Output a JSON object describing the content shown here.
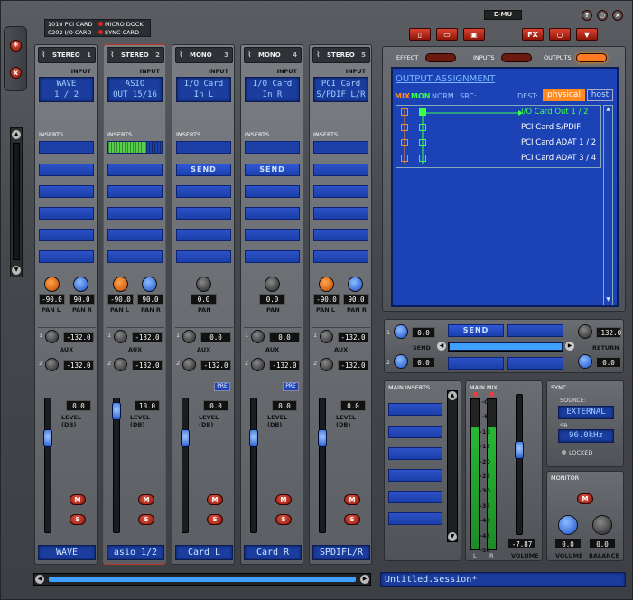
{
  "cards": {
    "line1": "1010 PCI CARD",
    "line2": "0202 I/O CARD",
    "micro": "MICRO DOCK",
    "sync": "SYNC CARD"
  },
  "brand": "E-MU",
  "window": {
    "help": "?",
    "min": "○",
    "close": "×"
  },
  "toolbar": {
    "fx": "FX",
    "labels": {
      "effect": "EFFECT",
      "inputs": "INPUTS",
      "outputs": "OUTPUTS"
    }
  },
  "side": {
    "star": "*",
    "x": "x"
  },
  "common": {
    "input": "INPUT",
    "inserts": "INSERTS",
    "send": "SEND",
    "pan": "PAN",
    "panl": "PAN L",
    "panr": "PAN R",
    "aux": "AUX",
    "level": "LEVEL (DB)",
    "mute": "M",
    "solo": "S",
    "pre": "PRE"
  },
  "strips": [
    {
      "type": "STEREO",
      "num": "1",
      "src1": "WAVE",
      "src2": "1 / 2",
      "stereo": true,
      "panL": "-90.0",
      "panR": "90.0",
      "aux1": "-132.0",
      "aux2": "-132.0",
      "level": "0.0",
      "name": "WAVE",
      "pre": false
    },
    {
      "type": "STEREO",
      "num": "2",
      "src1": "ASIO",
      "src2": "OUT 15/16",
      "stereo": true,
      "panL": "-90.0",
      "panR": "90.0",
      "aux1": "-132.0",
      "aux2": "-132.0",
      "level": "10.0",
      "name": "asio 1/2",
      "pre": false
    },
    {
      "type": "MONO",
      "num": "3",
      "src1": "I/O Card",
      "src2": "In L",
      "stereo": false,
      "pan": "0.0",
      "aux1": "0.0",
      "aux2": "-132.0",
      "level": "0.0",
      "name": "Card L",
      "pre": true
    },
    {
      "type": "MONO",
      "num": "4",
      "src1": "I/O Card",
      "src2": "In R",
      "stereo": false,
      "pan": "0.0",
      "aux1": "0.0",
      "aux2": "-132.0",
      "level": "0.0",
      "name": "Card R",
      "pre": true
    },
    {
      "type": "STEREO",
      "num": "5",
      "src1": "PCI Card",
      "src2": "S/PDIF L/R",
      "stereo": true,
      "panL": "-90.0",
      "panR": "90.0",
      "aux1": "-132.0",
      "aux2": "-132.0",
      "level": "0.0",
      "name": "SPDIFL/R",
      "pre": false
    }
  ],
  "output": {
    "title": "OUTPUT ASSIGNMENT",
    "mix": "MIX",
    "mon": "MON",
    "norm": "NORM",
    "src": "SRC:",
    "dest": "DEST:",
    "physical": "physical",
    "host": "host",
    "rows": [
      "I/O Card Out 1 / 2",
      "PCI Card S/PDIF",
      "PCI Card ADAT 1 / 2",
      "PCI Card ADAT 3 / 4"
    ]
  },
  "fxsend": {
    "send": "SEND",
    "return": "RETURN",
    "s1": "0.0",
    "s2": "0.0",
    "r1": "-132.0",
    "r2": "0.0",
    "n1": "1",
    "n2": "2"
  },
  "main": {
    "inserts": "MAIN INSERTS",
    "mix": "MAIN MIX",
    "l": "L",
    "r": "R",
    "volume": "VOLUME",
    "vol": "-7.87",
    "scale": [
      "-0",
      "-5",
      "-10",
      "-15",
      "-20",
      "-25",
      "-30",
      "-35",
      "-40",
      "-45",
      "-50"
    ]
  },
  "sync": {
    "title": "SYNC",
    "source": "SOURCE:",
    "src_val": "EXTERNAL",
    "sr": "SR",
    "sr_val": "96.0kHz",
    "locked": "LOCKED"
  },
  "monitor": {
    "title": "MONITOR",
    "m": "M",
    "volume": "VOLUME",
    "balance": "BALANCE",
    "vol": "0.0",
    "bal": "0.0"
  },
  "session": "Untitled.session*"
}
